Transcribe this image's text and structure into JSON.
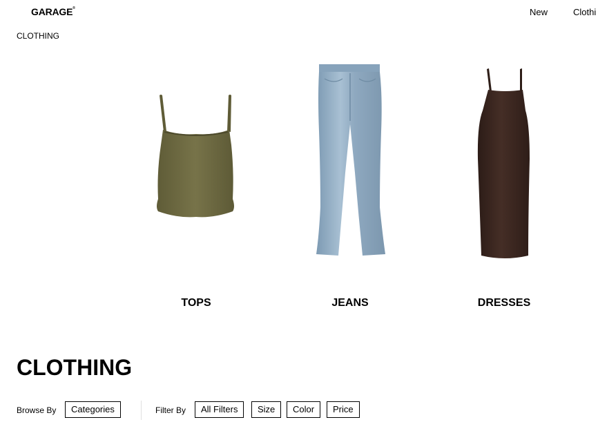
{
  "header": {
    "logo": "GARAGE",
    "nav": {
      "new": "New",
      "clothing": "Clothi"
    }
  },
  "breadcrumb": "CLOTHING",
  "categories": [
    {
      "label": "TOPS",
      "color": "#6f6b43"
    },
    {
      "label": "JEANS",
      "color": "#93b0c8"
    },
    {
      "label": "DRESSES",
      "color": "#3a2620"
    }
  ],
  "page_title": "CLOTHING",
  "filters": {
    "browse_label": "Browse By",
    "browse_buttons": [
      "Categories"
    ],
    "filter_label": "Filter By",
    "filter_buttons": [
      "All Filters",
      "Size",
      "Color",
      "Price"
    ]
  }
}
